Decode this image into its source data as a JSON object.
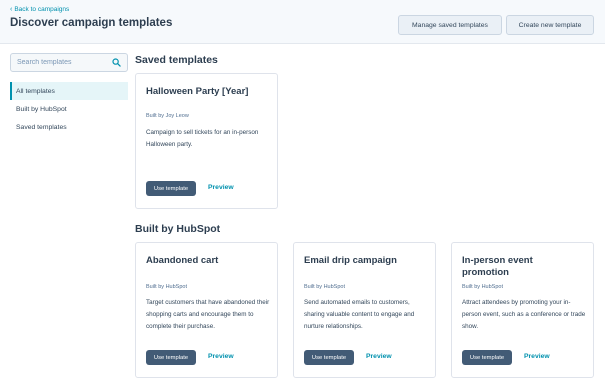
{
  "header": {
    "back_link": "Back to campaigns",
    "title": "Discover campaign templates",
    "manage_button": "Manage saved templates",
    "create_button": "Create new template"
  },
  "search": {
    "placeholder": "Search templates"
  },
  "sidebar": {
    "items": [
      {
        "label": "All templates",
        "active": true
      },
      {
        "label": "Built by HubSpot",
        "active": false
      },
      {
        "label": "Saved templates",
        "active": false
      }
    ]
  },
  "sections": {
    "saved_title": "Saved templates",
    "built_title": "Built by HubSpot"
  },
  "saved_templates": [
    {
      "title": "Halloween Party [Year]",
      "byline": "Built by Joy Leow",
      "description": "Campaign to sell tickets for an in-person Halloween party.",
      "use_label": "Use template",
      "preview_label": "Preview"
    }
  ],
  "built_templates": [
    {
      "title": "Abandoned cart",
      "byline": "Built by HubSpot",
      "description": "Target customers that have abandoned their shopping carts and encourage them to complete their purchase.",
      "use_label": "Use template",
      "preview_label": "Preview"
    },
    {
      "title": "Email drip campaign",
      "byline": "Built by HubSpot",
      "description": "Send automated emails to customers, sharing valuable content to engage and nurture relationships.",
      "use_label": "Use template",
      "preview_label": "Preview"
    },
    {
      "title": "In-person event promotion",
      "byline": "Built by HubSpot",
      "description": "Attract attendees by promoting your in-person event, such as a conference or trade show.",
      "use_label": "Use template",
      "preview_label": "Preview"
    }
  ],
  "colors": {
    "accent": "#0091ae",
    "primary_button": "#425b76",
    "header_bg": "#f6f9fc"
  },
  "icons": {
    "search": "search-icon",
    "back": "chevron-left-icon"
  }
}
